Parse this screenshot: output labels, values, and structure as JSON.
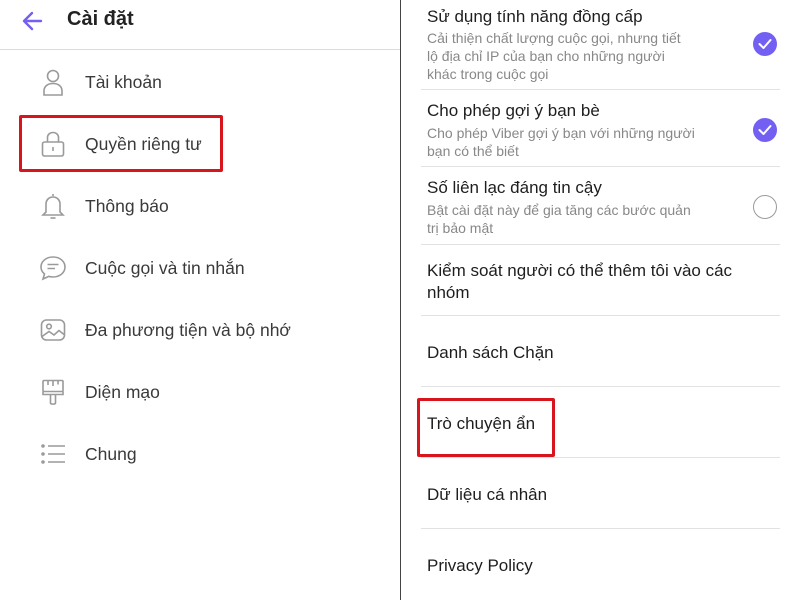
{
  "header": {
    "title": "Cài đặt"
  },
  "sidebar": {
    "items": [
      {
        "label": "Tài khoản",
        "icon": "user-icon"
      },
      {
        "label": "Quyền riêng tư",
        "icon": "lock-icon"
      },
      {
        "label": "Thông báo",
        "icon": "bell-icon"
      },
      {
        "label": "Cuộc gọi và tin nhắn",
        "icon": "chat-icon"
      },
      {
        "label": "Đa phương tiện và bộ nhớ",
        "icon": "image-icon"
      },
      {
        "label": "Diện mạo",
        "icon": "brush-icon"
      },
      {
        "label": "Chung",
        "icon": "list-icon"
      }
    ],
    "highlighted": "Quyền riêng tư"
  },
  "privacy": {
    "settings": [
      {
        "title": "Sử dụng tính năng đồng cấp",
        "desc_lines": [
          "Cải thiện chất lượng cuộc gọi, nhưng tiết",
          "lộ địa chỉ IP của bạn cho những người",
          "khác trong cuộc gọi"
        ],
        "checked": true
      },
      {
        "title": "Cho phép gợi ý bạn bè",
        "desc_lines": [
          "Cho phép Viber gợi ý bạn với những người",
          "bạn có thể biết"
        ],
        "checked": true
      },
      {
        "title": "Số liên lạc đáng tin cậy",
        "desc_lines": [
          "Bật cài đặt này để gia tăng các bước quản",
          "trị bảo mật"
        ],
        "checked": false
      }
    ],
    "links": [
      {
        "title_lines": [
          "Kiểm soát người có thể thêm tôi vào các",
          "nhóm"
        ]
      },
      {
        "title_lines": [
          "Danh sách Chặn"
        ]
      },
      {
        "title_lines": [
          "Trò chuyện ẩn"
        ]
      },
      {
        "title_lines": [
          "Dữ liệu cá nhân"
        ]
      },
      {
        "title_lines": [
          "Privacy Policy"
        ]
      }
    ],
    "highlighted": "Trò chuyện ẩn"
  },
  "colors": {
    "accent": "#7360f2",
    "highlight": "#d8141c",
    "back_arrow": "#7360f2"
  }
}
